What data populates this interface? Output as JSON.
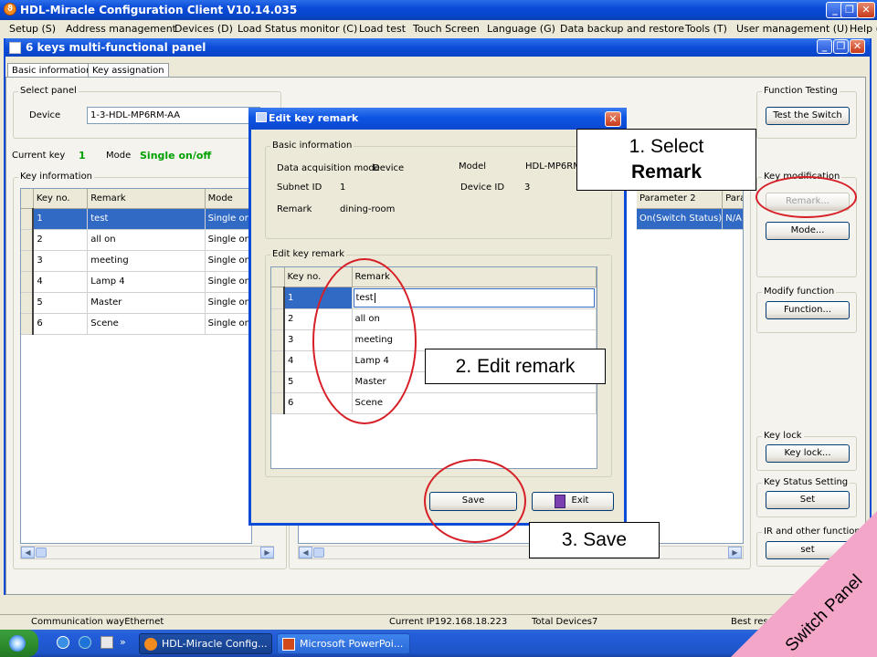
{
  "app": {
    "title": "HDL-Miracle Configuration Client V10.14.035",
    "menu": [
      "Setup (S)",
      "Address management",
      "Devices (D)",
      "Load Status monitor (C)",
      "Load test",
      "Touch Screen",
      "Language (G)",
      "Data backup and restore",
      "Tools (T)",
      "User management (U)",
      "Help ("
    ]
  },
  "child": {
    "title": "6 keys multi-functional panel",
    "tabs": [
      "Basic information",
      "Key assignation"
    ],
    "select_panel": {
      "label": "Select panel",
      "device_label": "Device",
      "device_value": "1-3-HDL-MP6RM-AA"
    },
    "current_key": {
      "label": "Current key",
      "value": "1",
      "mode_label": "Mode",
      "mode_value": "Single on/off"
    },
    "key_info": {
      "label": "Key information",
      "columns": [
        "Key no.",
        "Remark",
        "Mode"
      ],
      "rows": [
        [
          "1",
          "test",
          "Single on"
        ],
        [
          "2",
          "all on",
          "Single on"
        ],
        [
          "3",
          "meeting",
          "Single on"
        ],
        [
          "4",
          "Lamp 4",
          "Single on"
        ],
        [
          "5",
          "Master",
          "Single on"
        ],
        [
          "6",
          "Scene",
          "Single on"
        ]
      ]
    },
    "right_grid": {
      "columns": [
        "Parameter 2",
        "Parar"
      ],
      "rows": [
        [
          "On(Switch Status)",
          "N/A"
        ]
      ]
    },
    "function_testing": {
      "label": "Function Testing",
      "button": "Test the Switch"
    },
    "key_modification": {
      "label": "Key modification",
      "remark_button": "Remark...",
      "mode_button": "Mode..."
    },
    "modify_function": {
      "label": "Modify function",
      "button": "Function..."
    },
    "key_lock": {
      "label": "Key lock",
      "button": "Key lock..."
    },
    "key_status": {
      "label": "Key Status Setting",
      "button": "Set"
    },
    "ir_functions": {
      "label": "IR and other functions",
      "button": "set"
    }
  },
  "dialog": {
    "title": "Edit key remark",
    "basic_info": {
      "label": "Basic information",
      "acq_label": "Data acquisition mode",
      "acq_value": "Device",
      "model_label": "Model",
      "model_value": "HDL-MP6RM",
      "subnet_label": "Subnet ID",
      "subnet_value": "1",
      "device_label": "Device ID",
      "device_value": "3",
      "remark_label": "Remark",
      "remark_value": "dining-room"
    },
    "edit_section": {
      "label": "Edit key remark",
      "columns": [
        "Key no.",
        "Remark"
      ],
      "rows": [
        [
          "1",
          "test"
        ],
        [
          "2",
          "all on"
        ],
        [
          "3",
          "meeting"
        ],
        [
          "4",
          "Lamp 4"
        ],
        [
          "5",
          "Master"
        ],
        [
          "6",
          "Scene"
        ]
      ]
    },
    "save_button": "Save",
    "exit_button": "Exit"
  },
  "annotations": {
    "step1_line1": "1. Select",
    "step1_line2": "Remark",
    "step2": "2. Edit remark",
    "step3": "3. Save",
    "ribbon": "Switch Panel"
  },
  "statusbar": {
    "comm": "Communication wayEthernet",
    "ip": "Current IP192.168.18.223",
    "total": "Total Devices7",
    "best": "Best resc"
  },
  "taskbar": {
    "items": [
      "HDL-Miracle Config...",
      "Microsoft PowerPoi..."
    ]
  },
  "colors": {
    "accent": "#0b4bd6",
    "selection": "#316ac5",
    "annotation_red": "#d61f26",
    "ribbon_pink": "#f4a6c8",
    "ok_green": "#00a000"
  }
}
